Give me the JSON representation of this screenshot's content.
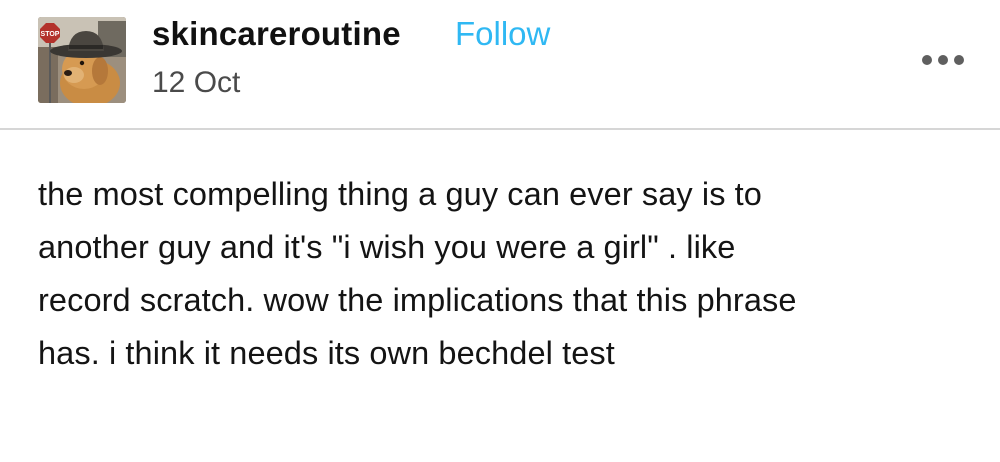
{
  "header": {
    "username": "skincareroutine",
    "follow_label": "Follow",
    "date": "12 Oct",
    "more_icon": "more-horizontal-icon",
    "avatar_sign_text": "STOP"
  },
  "post": {
    "text": "the most compelling thing a guy can ever say is to\nanother guy and it's \"i wish you were a girl\" . like\nrecord scratch. wow the implications that this phrase\nhas. i think it needs its own bechdel test"
  },
  "colors": {
    "follow": "#2fb8f3",
    "divider": "#d6d6d6",
    "text": "#141414"
  }
}
